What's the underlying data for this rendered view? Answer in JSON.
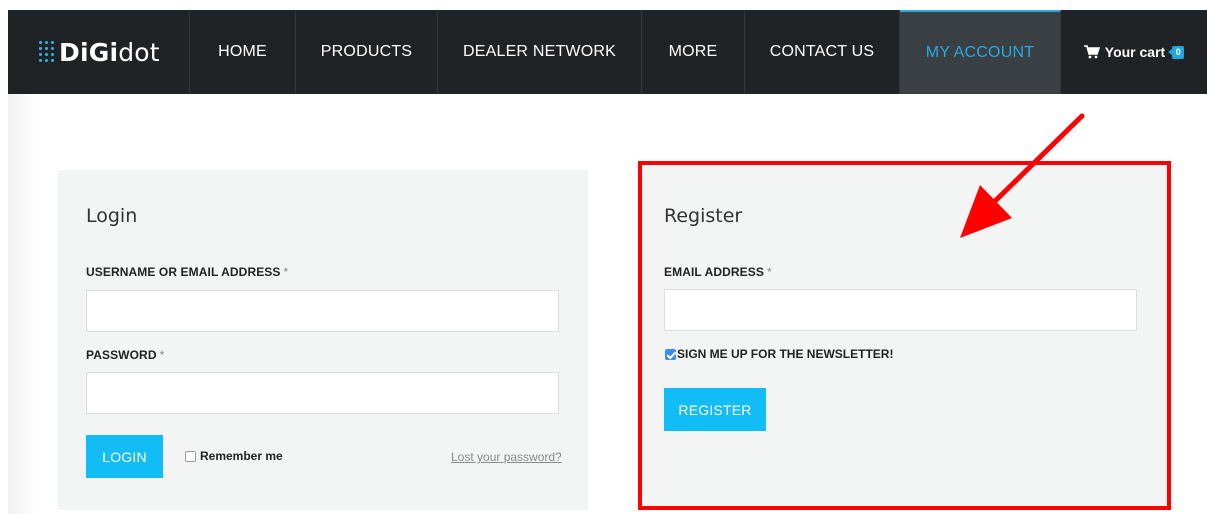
{
  "brand": {
    "logo_bold": "DiGi",
    "logo_light": "dot"
  },
  "nav": {
    "home": "HOME",
    "products": "PRODUCTS",
    "dealer_network": "DEALER NETWORK",
    "more": "MORE",
    "contact_us": "CONTACT US",
    "my_account": "MY ACCOUNT",
    "cart_label": "Your cart",
    "cart_count": "0"
  },
  "login": {
    "title": "Login",
    "username_label": "USERNAME OR EMAIL ADDRESS",
    "required_mark": "*",
    "username_value": "",
    "password_label": "PASSWORD",
    "password_value": "",
    "login_button": "LOGIN",
    "remember_label": "Remember me",
    "remember_checked": false,
    "lost_password": "Lost your password?"
  },
  "register": {
    "title": "Register",
    "email_label": "EMAIL ADDRESS",
    "required_mark": "*",
    "email_value": "",
    "newsletter_label": "SIGN ME UP FOR THE NEWSLETTER!",
    "newsletter_checked": true,
    "register_button": "REGISTER"
  },
  "colors": {
    "nav_bg": "#1f2326",
    "accent": "#11bdf4",
    "active_nav_text": "#2aa9e0",
    "panel_bg": "#f3f4f4",
    "highlight": "#ff0000"
  },
  "icons": {
    "cart": "shopping-cart-icon",
    "logo": "digidot-logo-icon",
    "annotation": "red-arrow-icon"
  }
}
